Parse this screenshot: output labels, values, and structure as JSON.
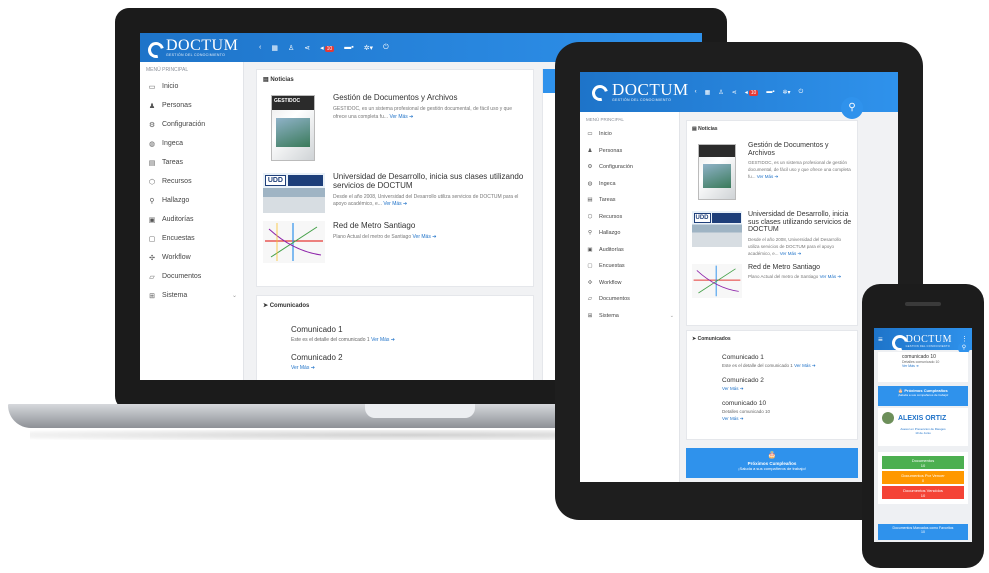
{
  "brand": {
    "name": "DOCTUM",
    "tagline": "GESTIÓN DEL CONOCIMIENTO",
    "colors": {
      "primary": "#1e74c9",
      "accent": "#2f92ec",
      "badge": "#e53935",
      "green": "#4caf50",
      "orange": "#ff9800",
      "red": "#f44336"
    }
  },
  "topbar": {
    "icons": [
      "chevron-left-icon",
      "grid-icon",
      "user-icon",
      "share-icon",
      "megaphone-icon",
      "mail-icon",
      "gear-icon",
      "power-icon"
    ],
    "notif_count": "10"
  },
  "menu": {
    "title": "MENÚ PRINCIPAL",
    "items": [
      {
        "label": "Inicio",
        "icon": "monitor-icon"
      },
      {
        "label": "Personas",
        "icon": "users-icon"
      },
      {
        "label": "Configuración",
        "icon": "gear-icon"
      },
      {
        "label": "Ingeca",
        "icon": "globe-icon"
      },
      {
        "label": "Tareas",
        "icon": "tasks-icon"
      },
      {
        "label": "Recursos",
        "icon": "cube-icon"
      },
      {
        "label": "Hallazgo",
        "icon": "search-icon"
      },
      {
        "label": "Auditorías",
        "icon": "briefcase-icon"
      },
      {
        "label": "Encuestas",
        "icon": "chat-icon"
      },
      {
        "label": "Workflow",
        "icon": "workflow-icon"
      },
      {
        "label": "Documentos",
        "icon": "folder-icon"
      },
      {
        "label": "Sistema",
        "icon": "apps-icon"
      }
    ]
  },
  "news": {
    "title": "Noticias",
    "items": [
      {
        "title": "Gestión de Documentos y Archivos",
        "text": "GESTIDOC, es un sistema profesional de gestión documental, de fácil uso y que ofrece una completa fu...",
        "more": "Ver Más"
      },
      {
        "title": "Universidad de Desarrollo, inicia sus clases utilizando servicios de DOCTUM",
        "text": "Desde el año 2008, Universidad del Desarrollo utiliza servicios de DOCTUM para el apoyo académico, e...",
        "more": "Ver Más"
      },
      {
        "title": "Red de Metro Santiago",
        "text": "Plano Actual del metro de Santiago",
        "more": "Ver Más"
      }
    ],
    "thumb_text": "GESTIDOC",
    "udd_text": "UDD"
  },
  "comunicados": {
    "title": "Comunicados",
    "items": [
      {
        "title": "Comunicado 1",
        "text": "Este es el detalle del comunicado 1",
        "more": "Ver Más"
      },
      {
        "title": "Comunicado 2",
        "text": "",
        "more": "Ver Más"
      },
      {
        "title": "comunicado 10",
        "text": "Detalles comunicado 10",
        "more": "Ver Más"
      }
    ]
  },
  "birthdays": {
    "title": "Próximos Cumpleaños",
    "subtitle": "¡Saluda a sus compañeros de trabajo!",
    "person": "ALEXIS ORTIZ",
    "role": "Asesor en Prevencion de Riesgos",
    "date": "10 de Junio"
  },
  "tiles": [
    {
      "label": "Documentos",
      "count": "10",
      "color": "#4caf50"
    },
    {
      "label": "Documentos Por Vencer",
      "count": "0",
      "color": "#ff9800"
    },
    {
      "label": "Documentos Vencidos",
      "count": "10",
      "color": "#f44336"
    }
  ],
  "favorites": {
    "label": "Documentos Marcados como Favoritos",
    "count": "10"
  }
}
